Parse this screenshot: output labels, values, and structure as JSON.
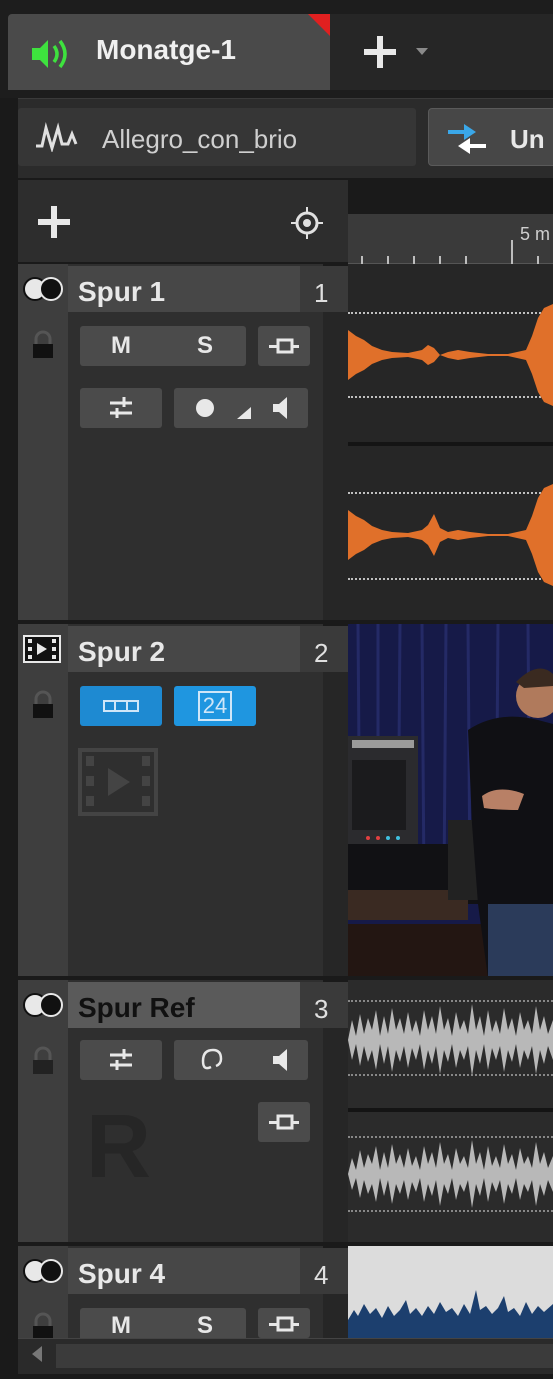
{
  "tabs": {
    "active_title": "Monatge-1",
    "new_tab_label": "+"
  },
  "file_bar": {
    "file_name": "Allegro_con_brio",
    "button_label": "Un"
  },
  "ruler": {
    "label": "5 m"
  },
  "tracks": [
    {
      "name": "Spur 1",
      "number": "1",
      "type": "stereo-audio",
      "mute_label": "M",
      "solo_label": "S"
    },
    {
      "name": "Spur 2",
      "number": "2",
      "type": "video",
      "fps_label": "24"
    },
    {
      "name": "Spur Ref",
      "number": "3",
      "type": "reference",
      "ref_letter": "R"
    },
    {
      "name": "Spur 4",
      "number": "4",
      "type": "stereo-audio",
      "mute_label": "M",
      "solo_label": "S"
    }
  ],
  "colors": {
    "waveform_orange": "#e0702a",
    "waveform_gray": "#b8b8b8",
    "waveform_blue": "#1c3f6e",
    "selection_blue": "#1e8ad2",
    "speaker_green": "#3ee23e",
    "modified_red": "#e02020"
  },
  "icons": [
    "speaker-icon",
    "plus-icon",
    "dropdown-arrow-icon",
    "waveform-icon",
    "swap-arrows-icon",
    "add-track-icon",
    "locate-icon",
    "stereo-icon",
    "lock-icon",
    "bypass-icon",
    "settings-icon",
    "record-icon",
    "level-icon",
    "monitor-speaker-icon",
    "video-film-icon",
    "ear-icon"
  ]
}
